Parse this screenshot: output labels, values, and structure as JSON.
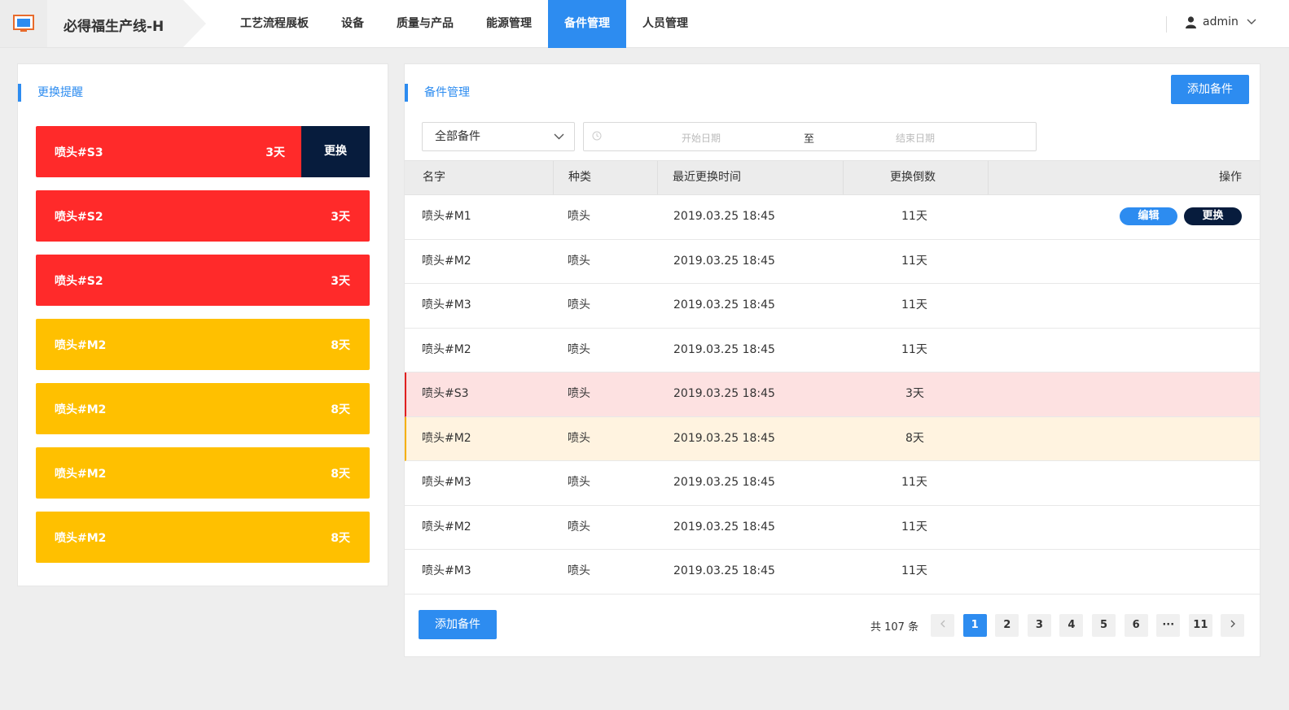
{
  "header": {
    "app_title": "必得福生产线-H",
    "nav": [
      {
        "label": "工艺流程展板",
        "active": false
      },
      {
        "label": "设备",
        "active": false
      },
      {
        "label": "质量与产品",
        "active": false
      },
      {
        "label": "能源管理",
        "active": false
      },
      {
        "label": "备件管理",
        "active": true
      },
      {
        "label": "人员管理",
        "active": false
      }
    ],
    "user": "admin"
  },
  "reminder": {
    "title": "更换提醒",
    "items": [
      {
        "name": "喷头#S3",
        "days": "3天",
        "level": "red",
        "action": "更换"
      },
      {
        "name": "喷头#S2",
        "days": "3天",
        "level": "red"
      },
      {
        "name": "喷头#S2",
        "days": "3天",
        "level": "red"
      },
      {
        "name": "喷头#M2",
        "days": "8天",
        "level": "yellow"
      },
      {
        "name": "喷头#M2",
        "days": "8天",
        "level": "yellow"
      },
      {
        "name": "喷头#M2",
        "days": "8天",
        "level": "yellow"
      },
      {
        "name": "喷头#M2",
        "days": "8天",
        "level": "yellow"
      }
    ]
  },
  "spares": {
    "title": "备件管理",
    "add_label": "添加备件",
    "filter": {
      "category": "全部备件",
      "start_placeholder": "开始日期",
      "separator": "至",
      "end_placeholder": "结束日期"
    },
    "columns": [
      "名字",
      "种类",
      "最近更换时间",
      "更换倒数",
      "操作"
    ],
    "rows": [
      {
        "name": "喷头#M1",
        "type": "喷头",
        "time": "2019.03.25 18:45",
        "countdown": "11天",
        "level": "",
        "actions": [
          "编辑",
          "更换"
        ]
      },
      {
        "name": "喷头#M2",
        "type": "喷头",
        "time": "2019.03.25 18:45",
        "countdown": "11天",
        "level": ""
      },
      {
        "name": "喷头#M3",
        "type": "喷头",
        "time": "2019.03.25 18:45",
        "countdown": "11天",
        "level": ""
      },
      {
        "name": "喷头#M2",
        "type": "喷头",
        "time": "2019.03.25 18:45",
        "countdown": "11天",
        "level": ""
      },
      {
        "name": "喷头#S3",
        "type": "喷头",
        "time": "2019.03.25 18:45",
        "countdown": "3天",
        "level": "red"
      },
      {
        "name": "喷头#M2",
        "type": "喷头",
        "time": "2019.03.25 18:45",
        "countdown": "8天",
        "level": "yellow"
      },
      {
        "name": "喷头#M3",
        "type": "喷头",
        "time": "2019.03.25 18:45",
        "countdown": "11天",
        "level": ""
      },
      {
        "name": "喷头#M2",
        "type": "喷头",
        "time": "2019.03.25 18:45",
        "countdown": "11天",
        "level": ""
      },
      {
        "name": "喷头#M3",
        "type": "喷头",
        "time": "2019.03.25 18:45",
        "countdown": "11天",
        "level": ""
      }
    ],
    "pagination": {
      "total": "共 107 条",
      "pages": [
        "1",
        "2",
        "3",
        "4",
        "5",
        "6",
        "···",
        "11"
      ],
      "current": "1"
    }
  },
  "colors": {
    "accent": "#2d8cf0",
    "danger": "#ff2a2a",
    "warning": "#ffc000",
    "dark": "#071c3d"
  }
}
